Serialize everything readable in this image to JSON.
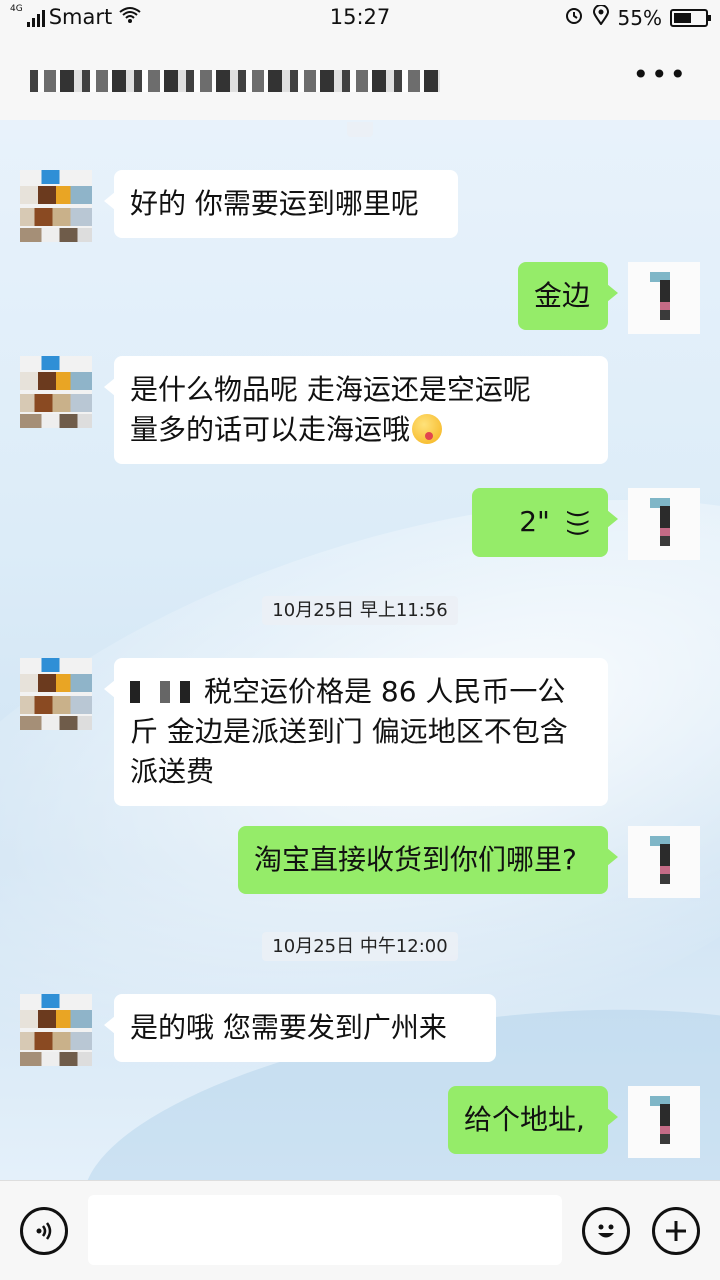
{
  "status_bar": {
    "network": "4G",
    "carrier": "Smart",
    "time": "15:27",
    "battery": "55%",
    "battery_level": 0.55,
    "icons": [
      "signal-icon",
      "wifi-icon",
      "alarm-icon",
      "location-icon",
      "battery-icon"
    ]
  },
  "header": {
    "more_icon": "•••"
  },
  "chat": {
    "timestamps": [
      "10月25日 早上11:56",
      "10月25日 中午12:00"
    ],
    "messages": [
      {
        "side": "in",
        "text": "好的  你需要运到哪里呢"
      },
      {
        "side": "out",
        "text": "金边"
      },
      {
        "side": "in",
        "line1": "是什么物品呢    走海运还是空运呢",
        "line2": "量多的话可以走海运哦"
      },
      {
        "side": "out",
        "type": "voice",
        "duration": "2\""
      },
      {
        "side": "in",
        "line1": "税空运价格是 86 人民币一公",
        "line2": "斤 金边是派送到门 偏远地区不包含",
        "line3": "派送费"
      },
      {
        "side": "out",
        "text": "淘宝直接收货到你们哪里?"
      },
      {
        "side": "in",
        "text": "是的哦   您需要发到广州来"
      },
      {
        "side": "out",
        "text": "给个地址,"
      }
    ]
  },
  "input_bar": {
    "voice_icon": "voice-toggle-icon",
    "emoji_icon": "emoji-icon",
    "plus_icon": "plus-icon"
  },
  "colors": {
    "outgoing_bubble": "#95ec69",
    "incoming_bubble": "#ffffff"
  }
}
